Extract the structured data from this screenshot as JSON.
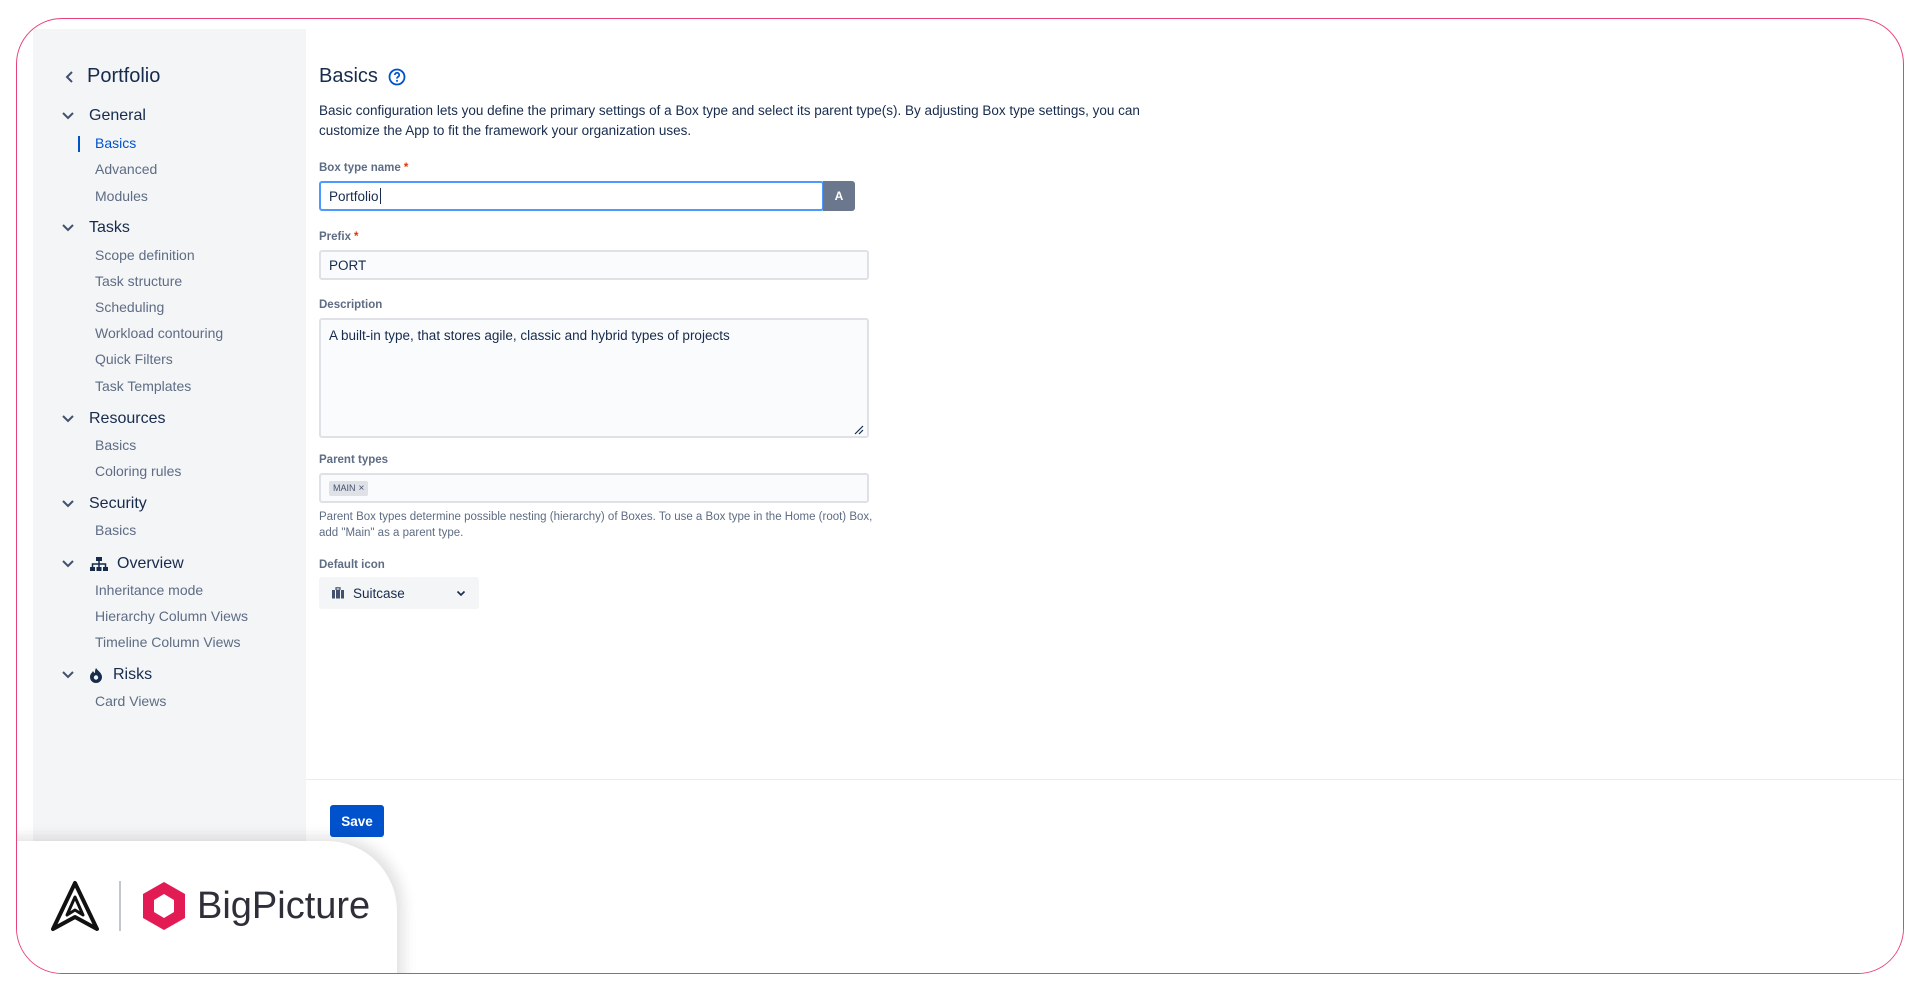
{
  "sidebar": {
    "title": "Portfolio",
    "groups": [
      {
        "label": "General",
        "items": [
          "Basics",
          "Advanced",
          "Modules"
        ]
      },
      {
        "label": "Tasks",
        "items": [
          "Scope definition",
          "Task structure",
          "Scheduling",
          "Workload contouring",
          "Quick Filters",
          "Task Templates"
        ]
      },
      {
        "label": "Resources",
        "items": [
          "Basics",
          "Coloring rules"
        ]
      },
      {
        "label": "Security",
        "items": [
          "Basics"
        ]
      },
      {
        "label": "Overview",
        "items": [
          "Inheritance mode",
          "Hierarchy Column Views",
          "Timeline Column Views"
        ]
      },
      {
        "label": "Risks",
        "items": [
          "Card Views"
        ]
      }
    ]
  },
  "main": {
    "title": "Basics",
    "description": "Basic configuration lets you define the primary settings of a Box type and select its parent type(s). By adjusting Box type settings, you can customize the App to fit the framework your organization uses.",
    "fields": {
      "box_type_name_label": "Box type name",
      "box_type_name_value": "Portfolio",
      "affix_label": "A",
      "prefix_label": "Prefix",
      "prefix_value": "PORT",
      "description_label": "Description",
      "description_value": "A built-in type, that stores agile, classic and hybrid types of projects",
      "parent_types_label": "Parent types",
      "parent_tag": "MAIN",
      "parent_help": "Parent Box types determine possible nesting (hierarchy) of Boxes. To use a Box type in the Home (root) Box, add \"Main\" as a parent type.",
      "default_icon_label": "Default icon",
      "default_icon_value": "Suitcase",
      "required_mark": "*"
    },
    "save_label": "Save"
  },
  "brand": {
    "name": "BigPicture"
  },
  "colors": {
    "accent": "#0052cc",
    "frame": "#e8417a",
    "brand": "#e31b54"
  }
}
